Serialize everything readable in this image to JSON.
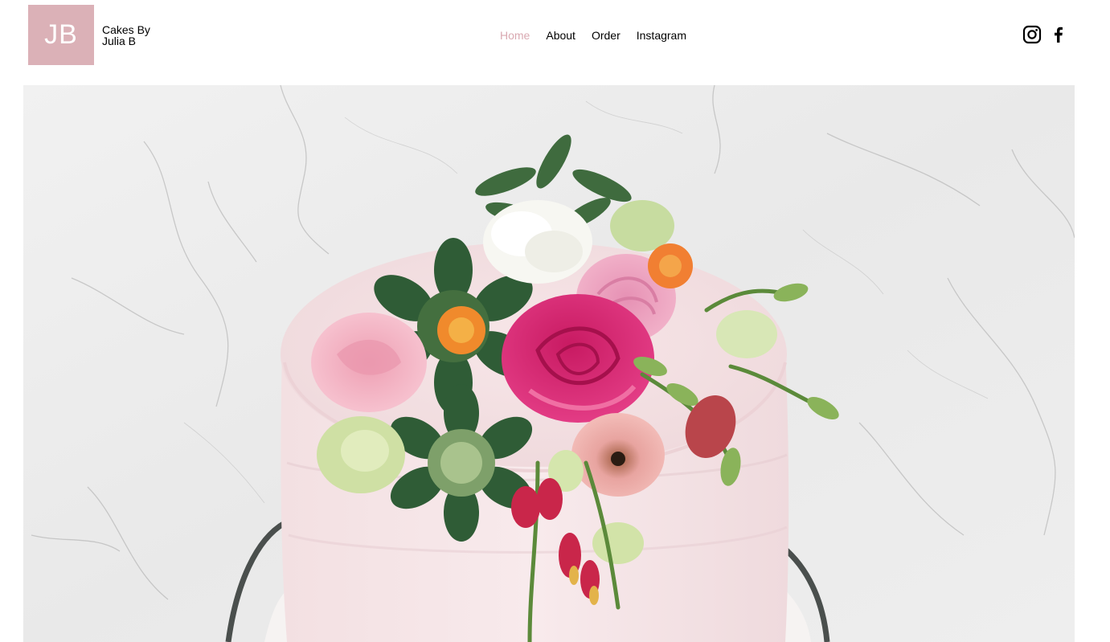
{
  "logo": {
    "initials": "JB",
    "background": "#dbb1b7"
  },
  "brand": {
    "line1": "Cakes By",
    "line2": "Julia B"
  },
  "nav": {
    "items": [
      {
        "label": "Home",
        "active": true
      },
      {
        "label": "About",
        "active": false
      },
      {
        "label": "Order",
        "active": false
      },
      {
        "label": "Instagram",
        "active": false
      }
    ],
    "active_color": "#d9a9b1"
  },
  "social": {
    "icons": [
      "instagram-icon",
      "facebook-icon"
    ]
  },
  "hero": {
    "image_subject": "pink-frosted cake topped with fresh flowers on marble background"
  }
}
